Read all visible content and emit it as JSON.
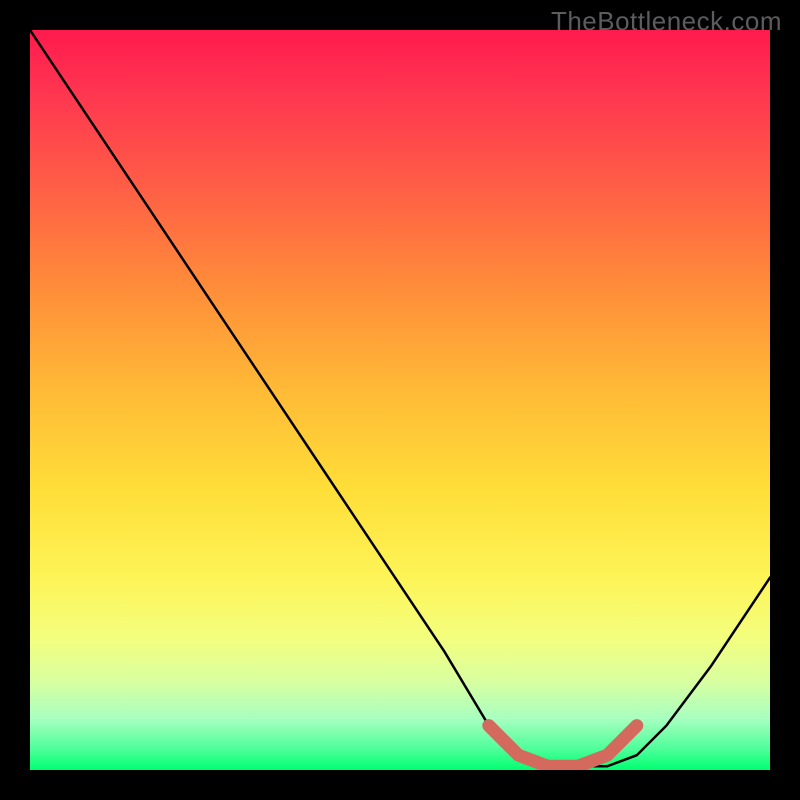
{
  "watermark": "TheBottleneck.com",
  "chart_data": {
    "type": "line",
    "title": "",
    "xlabel": "",
    "ylabel": "",
    "xlim": [
      0,
      100
    ],
    "ylim": [
      0,
      100
    ],
    "series": [
      {
        "name": "bottleneck-curve",
        "x": [
          0,
          8,
          16,
          24,
          32,
          40,
          48,
          56,
          62,
          66,
          70,
          74,
          78,
          82,
          86,
          92,
          100
        ],
        "values": [
          100,
          88,
          76,
          64,
          52,
          40,
          28,
          16,
          6,
          2,
          0.5,
          0.5,
          0.5,
          2,
          6,
          14,
          26
        ]
      }
    ],
    "highlight_segment": {
      "name": "trough-marker",
      "color": "#d4695e",
      "x": [
        62,
        66,
        70,
        74,
        78,
        82
      ],
      "values": [
        6,
        2,
        0.5,
        0.5,
        2,
        6
      ]
    },
    "background": "rainbow-gradient-red-to-green"
  }
}
